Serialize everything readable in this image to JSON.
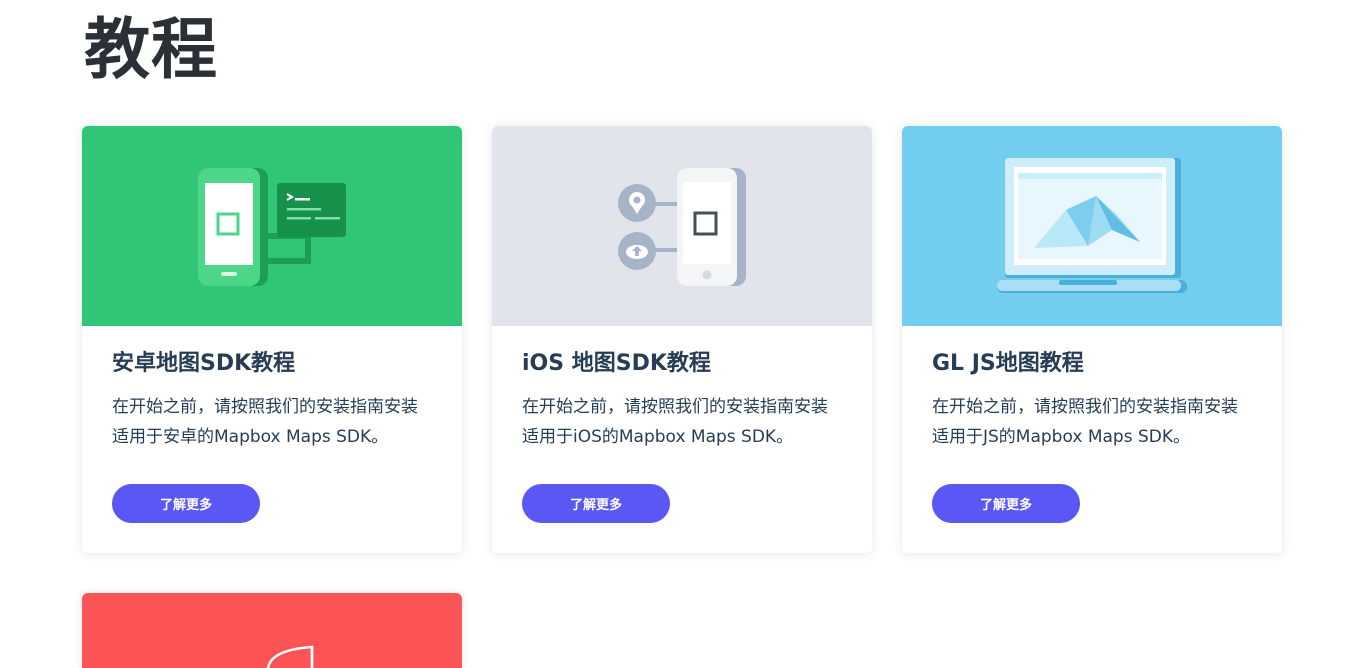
{
  "page": {
    "title": "教程"
  },
  "cards": [
    {
      "title": "安卓地图SDK教程",
      "description": "在开始之前，请按照我们的安装指南安装适用于安卓的Mapbox Maps SDK。",
      "button_label": "了解更多",
      "hero_color": "#31c576",
      "icon": "android-phone-terminal-illustration"
    },
    {
      "title": "iOS 地图SDK教程",
      "description": "在开始之前，请按照我们的安装指南安装适用于iOS的Mapbox Maps SDK。",
      "button_label": "了解更多",
      "hero_color": "#e1e5eb",
      "icon": "ios-phone-location-upload-illustration"
    },
    {
      "title": "GL JS地图教程",
      "description": "在开始之前，请按照我们的安装指南安装适用于JS的Mapbox Maps SDK。",
      "button_label": "了解更多",
      "hero_color": "#72cdef",
      "icon": "laptop-map-illustration"
    },
    {
      "title": "",
      "description": "",
      "button_label": "",
      "hero_color": "#fb5356",
      "icon": "partial-illustration"
    }
  ],
  "colors": {
    "accent_button": "#5a57f5",
    "text": "#273d56"
  }
}
